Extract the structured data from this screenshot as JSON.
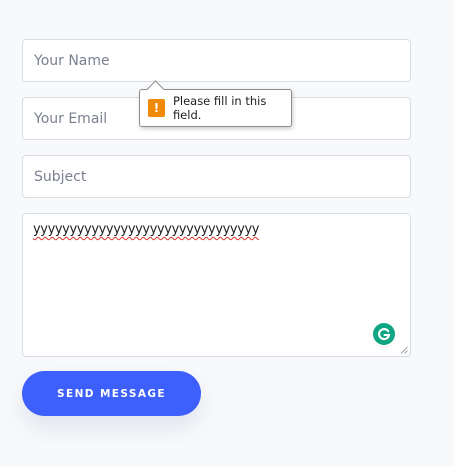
{
  "form": {
    "name_placeholder": "Your Name",
    "email_placeholder": "Your Email",
    "subject_placeholder": "Subject",
    "message_value": "yyyyyyyyyyyyyyyyyyyyyyyyyyyyyyy",
    "send_label": "SEND MESSAGE"
  },
  "validation": {
    "message": "Please fill in this field.",
    "icon": "warning-icon",
    "icon_glyph": "!"
  },
  "grammarly": {
    "icon": "grammarly-icon",
    "glyph": "G"
  },
  "colors": {
    "accent": "#3d5ffb",
    "warning": "#f08a0b",
    "grammarly": "#11a683",
    "spellcheck": "#e0342c"
  }
}
